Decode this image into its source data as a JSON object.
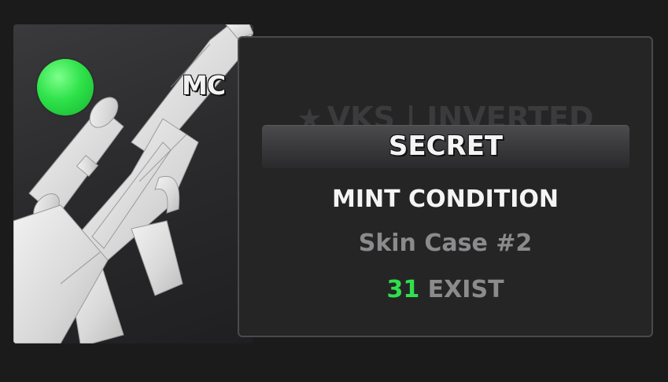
{
  "item_card": {
    "condition_short": "MC",
    "status_color": "#2fe24a",
    "weapon_icon": "sniper-rifle-icon"
  },
  "info_panel": {
    "star": "★",
    "item_name": "VKS | INVERTED",
    "rarity": "SECRET",
    "condition": "MINT CONDITION",
    "case_name": "Skin Case #2",
    "exist_count": "31",
    "exist_label": "EXIST"
  },
  "colors": {
    "exist_count": "#2ee04c",
    "panel_background": "#252526",
    "muted_text": "#8b8b8d"
  }
}
